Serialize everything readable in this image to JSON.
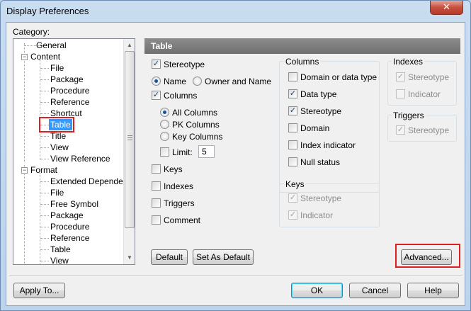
{
  "window": {
    "title": "Display Preferences",
    "close_glyph": "✕"
  },
  "category": {
    "label": "Category:",
    "items": [
      {
        "text": "General",
        "level": 1
      },
      {
        "text": "Content",
        "level": 0,
        "expanded": true
      },
      {
        "text": "File",
        "level": 1
      },
      {
        "text": "Package",
        "level": 1
      },
      {
        "text": "Procedure",
        "level": 1
      },
      {
        "text": "Reference",
        "level": 1
      },
      {
        "text": "Shortcut",
        "level": 1
      },
      {
        "text": "Table",
        "level": 1,
        "selected": true
      },
      {
        "text": "Title",
        "level": 1
      },
      {
        "text": "View",
        "level": 1
      },
      {
        "text": "View Reference",
        "level": 1
      },
      {
        "text": "Format",
        "level": 0,
        "expanded": true
      },
      {
        "text": "Extended Dependency",
        "level": 1
      },
      {
        "text": "File",
        "level": 1
      },
      {
        "text": "Free Symbol",
        "level": 1
      },
      {
        "text": "Package",
        "level": 1
      },
      {
        "text": "Procedure",
        "level": 1
      },
      {
        "text": "Reference",
        "level": 1
      },
      {
        "text": "Table",
        "level": 1
      },
      {
        "text": "View",
        "level": 1
      }
    ]
  },
  "pane": {
    "header": "Table",
    "stereotype": {
      "label": "Stereotype",
      "checked": true
    },
    "name_radio": {
      "label": "Name",
      "selected": true
    },
    "owner_radio": {
      "label": "Owner and Name",
      "selected": false
    },
    "columns": {
      "label": "Columns",
      "checked": true
    },
    "all_columns": {
      "label": "All Columns",
      "selected": true
    },
    "pk_columns": {
      "label": "PK Columns",
      "selected": false
    },
    "key_columns": {
      "label": "Key Columns",
      "selected": false
    },
    "limit": {
      "label": "Limit:",
      "checked": false,
      "value": "5"
    },
    "keys": {
      "label": "Keys",
      "checked": false
    },
    "indexes": {
      "label": "Indexes",
      "checked": false
    },
    "triggers": {
      "label": "Triggers",
      "checked": false
    },
    "comment": {
      "label": "Comment",
      "checked": false
    },
    "columns_group": {
      "title": "Columns",
      "items": [
        {
          "label": "Domain or data type",
          "checked": false
        },
        {
          "label": "Data type",
          "checked": true
        },
        {
          "label": "Stereotype",
          "checked": true
        },
        {
          "label": "Domain",
          "checked": false
        },
        {
          "label": "Index indicator",
          "checked": false
        },
        {
          "label": "Null status",
          "checked": false
        }
      ]
    },
    "keys_group": {
      "title": "Keys",
      "items": [
        {
          "label": "Stereotype",
          "checked": true
        },
        {
          "label": "Indicator",
          "checked": true
        }
      ]
    },
    "indexes_group": {
      "title": "Indexes",
      "items": [
        {
          "label": "Stereotype",
          "checked": true
        },
        {
          "label": "Indicator",
          "checked": false
        }
      ]
    },
    "triggers_group": {
      "title": "Triggers",
      "items": [
        {
          "label": "Stereotype",
          "checked": true
        }
      ]
    },
    "default_btn": "Default",
    "set_default_btn": "Set As Default",
    "advanced_btn": "Advanced..."
  },
  "footer": {
    "apply_to": "Apply To...",
    "ok": "OK",
    "cancel": "Cancel",
    "help": "Help"
  },
  "check_glyph": "✓",
  "colors": {
    "selection": "#3399ff",
    "highlight_box": "#e02020",
    "header_bg": "#7b7b7b"
  }
}
